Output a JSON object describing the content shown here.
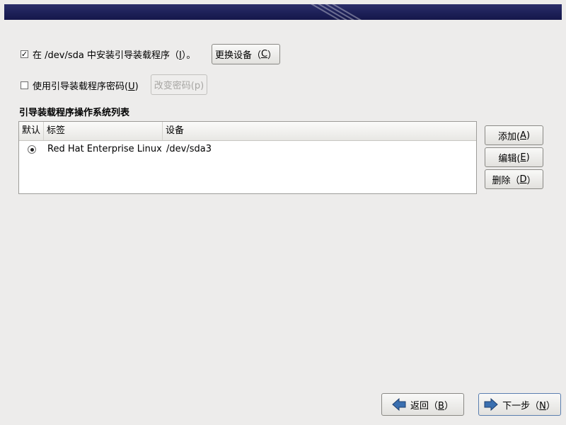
{
  "install_bootloader": {
    "checked": true,
    "label_pre": "在 /dev/sda 中安装引导装载程序（",
    "label_key": "I",
    "label_post": "）。",
    "change_device_pre": "更换设备（",
    "change_device_key": "C",
    "change_device_post": "）"
  },
  "bootloader_password": {
    "checked": false,
    "label_pre": "使用引导装载程序密码(",
    "label_key": "U",
    "label_post": ")",
    "change_password_label": "改变密码(p)"
  },
  "os_list": {
    "title": "引导装载程序操作系统列表",
    "columns": {
      "default": "默认",
      "label": "标签",
      "device": "设备"
    },
    "rows": [
      {
        "default": true,
        "label": "Red Hat Enterprise Linux",
        "device": "/dev/sda3"
      }
    ]
  },
  "side_buttons": {
    "add_pre": "添加(",
    "add_key": "A",
    "add_post": ")",
    "edit_pre": "编辑(",
    "edit_key": "E",
    "edit_post": ")",
    "delete_pre": "删除（",
    "delete_key": "D",
    "delete_post": "）"
  },
  "nav": {
    "back_pre": "返回（",
    "back_key": "B",
    "back_post": "）",
    "next_pre": "下一步（",
    "next_key": "N",
    "next_post": "）"
  },
  "colors": {
    "banner": "#1d2058",
    "background": "#edeceb",
    "nav_arrow": "#3a6fb0"
  },
  "icons": {
    "back": "arrow-left-icon",
    "next": "arrow-right-icon",
    "checkbox_checked": "check-icon",
    "radio_selected": "radio-dot-icon"
  }
}
